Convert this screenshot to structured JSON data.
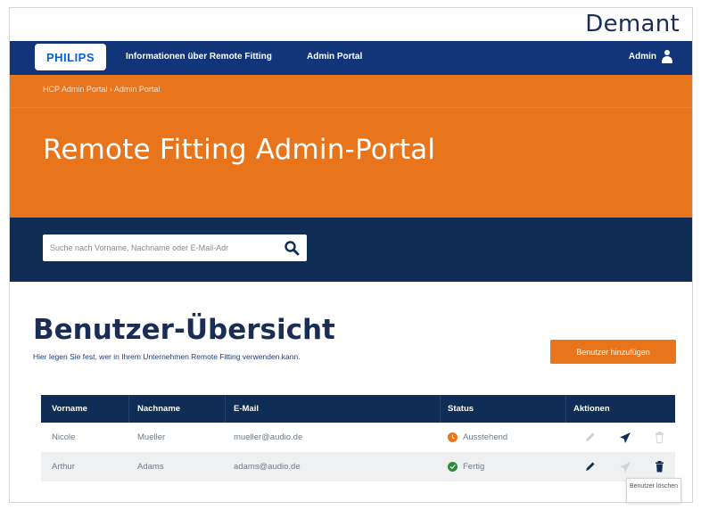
{
  "brand": {
    "demant_logo": "Demant",
    "philips_logo": "PHILIPS"
  },
  "nav": {
    "links": [
      "Informationen über Remote Fitting",
      "Admin Portal"
    ],
    "user_label": "Admin",
    "user_icon": "user-icon"
  },
  "hero": {
    "breadcrumb": "HCP Admin Portal › Admin Portal",
    "title": "Remote Fitting Admin-Portal"
  },
  "search": {
    "placeholder": "Suche nach Vorname, Nachname oder E-Mail-Adr",
    "value": "",
    "icon": "search-icon"
  },
  "users": {
    "title": "Benutzer-Übersicht",
    "subtitle": "Hier legen Sie fest, wer in Ihrem Unternehmen Remote Fitting verwenden kann.",
    "add_button": "Benutzer hinzufügen",
    "columns": [
      "Vorname",
      "Nachname",
      "E-Mail",
      "Status",
      "Aktionen"
    ],
    "rows": [
      {
        "vorname": "Nicole",
        "nachname": "Mueller",
        "email": "mueller@audio.de",
        "status": "Ausstehend",
        "status_kind": "pending",
        "edit_enabled": false,
        "send_enabled": true,
        "delete_enabled": false
      },
      {
        "vorname": "Arthur",
        "nachname": "Adams",
        "email": "adams@audio.de",
        "status": "Fertig",
        "status_kind": "ok",
        "edit_enabled": true,
        "send_enabled": false,
        "delete_enabled": true
      }
    ],
    "tooltip": "Benutzer löschen"
  },
  "colors": {
    "navy": "#12357a",
    "dark_navy": "#0f2d55",
    "orange": "#e8741c",
    "status_ok": "#2e8b3e",
    "status_pending": "#e8741c"
  }
}
